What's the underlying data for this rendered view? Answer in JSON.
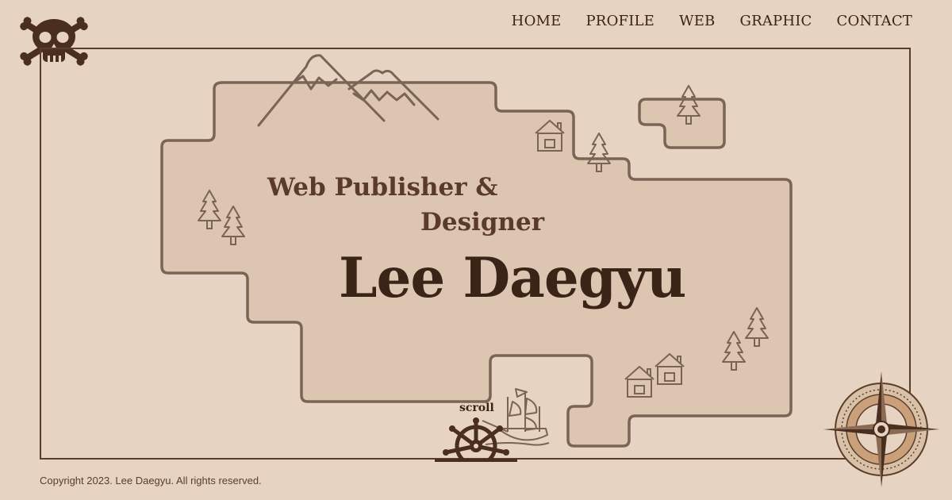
{
  "nav": {
    "items": [
      {
        "label": "HOME"
      },
      {
        "label": "PROFILE"
      },
      {
        "label": "WEB"
      },
      {
        "label": "GRAPHIC"
      },
      {
        "label": "CONTACT"
      }
    ]
  },
  "hero": {
    "subtitle_line1": "Web Publisher &",
    "subtitle_line2": "Designer",
    "name": "Lee Daegyu",
    "scroll_label": "scroll"
  },
  "footer": {
    "copyright": "Copyright 2023. Lee Daegyu. All rights reserved."
  },
  "icons": {
    "logo": "skull-crossbones-icon",
    "scroll": "ship-wheel-icon",
    "compass": "compass-rose-icon"
  },
  "colors": {
    "background": "#e6d3c1",
    "map_fill": "#dcc5b1",
    "outline": "#7a6455",
    "text_dark": "#3a2417",
    "text_medium": "#5a3a28"
  }
}
